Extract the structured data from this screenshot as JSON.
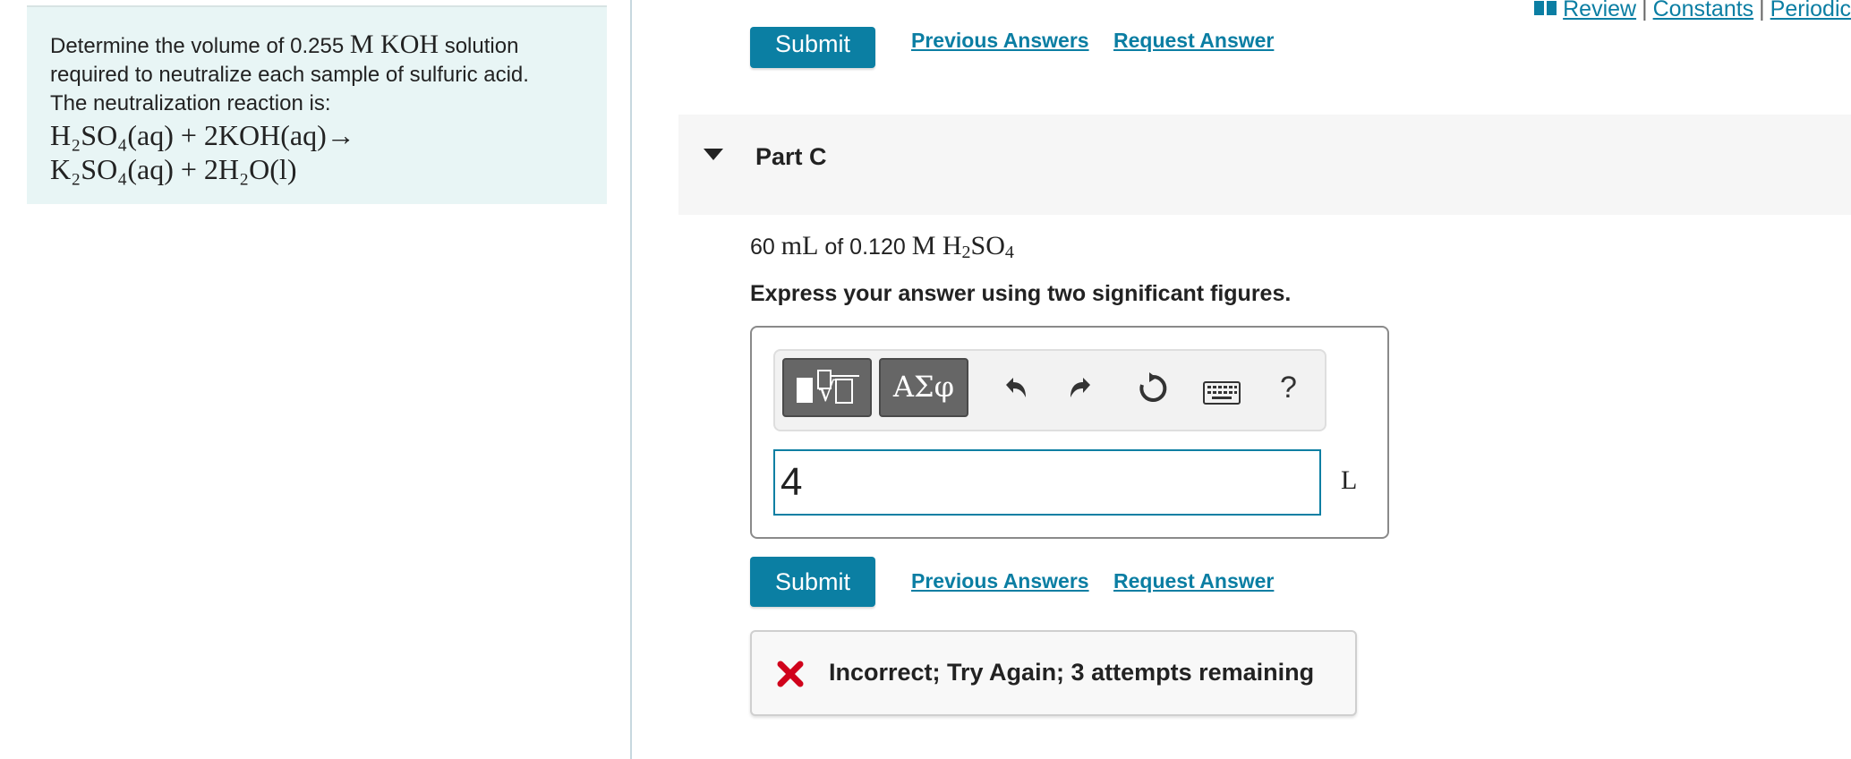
{
  "problem": {
    "line1_pre": "Determine the volume of 0.255",
    "line1_math": "M KOH",
    "line1_post": "solution",
    "line2": "required to neutralize each sample of sulfuric acid.",
    "line3": "The neutralization reaction is:",
    "eq_line1": "H₂SO₄(aq) + 2KOH(aq)→",
    "eq_line2": "K₂SO₄(aq) + 2H₂O(l)"
  },
  "top_links": {
    "review": "Review",
    "constants": "Constants",
    "periodic": "Periodic",
    "separator": "|"
  },
  "prev_part": {
    "submit": "Submit",
    "previous_answers": "Previous Answers",
    "request_answer": "Request Answer"
  },
  "part": {
    "title": "Part C",
    "question_num": "60",
    "question_unit": "mL",
    "question_of": "of 0.120",
    "question_conc": "M H",
    "question_sub1": "2",
    "question_so": "SO",
    "question_sub2": "4",
    "instruction": "Express your answer using two significant figures."
  },
  "toolbar": {
    "templates_icon": "templates-icon",
    "greek_label": "ΑΣφ",
    "help_label": "?"
  },
  "answer": {
    "value": "4",
    "unit": "L"
  },
  "actions": {
    "submit": "Submit",
    "previous_answers": "Previous Answers",
    "request_answer": "Request Answer"
  },
  "feedback": {
    "message": "Incorrect; Try Again; 3 attempts remaining"
  },
  "colors": {
    "accent": "#0b7fa3",
    "problem_bg": "#e8f5f5",
    "error": "#d0021b"
  }
}
